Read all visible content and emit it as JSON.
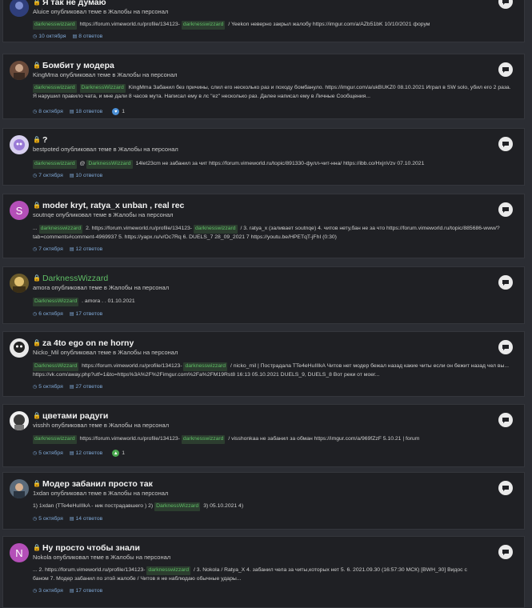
{
  "topics": [
    {
      "title": "Я так не думаю",
      "green_title": false,
      "subtitle": "Aluice опубликовал теме в Жалобы на персонал",
      "tags": [
        "darknesswizzard",
        "darknesswizzard"
      ],
      "snippet_before": "",
      "snippet_parts": [
        "",
        "https://forum.vimeworld.ru/profile/134123-",
        "/ Yeekon неверно закрыл жалобу https://imgur.com/a/AZb51bK 10/10/2021 форум"
      ],
      "date": "10 октября",
      "replies": "8 ответов",
      "reaction": ""
    },
    {
      "title": "Бомбит у модера",
      "subtitle": "KingMma опубликовал теме в Жалобы на персонал",
      "snippet_a": "KingMma Забанил без причины, слил его несколько раз и походу бомбануло. https://imgur.com/a/ukBUKZ0 08.10.2021 Играл в SW solo, убил его 2 раза.",
      "snippet_b": "Я нарушил правило чата, и мне дали 8 часов мута. Написал ему в лс \"ez\" несколько раз. Далее написал ему в Личные Сообщения...",
      "tag1": "darknesswizzard",
      "tag2": "DarknessWizzard",
      "date": "8 октября",
      "replies": "18 ответов",
      "reaction": "1"
    },
    {
      "title": "?",
      "subtitle": "bestpoted опубликовал теме в Жалобы на персонал",
      "tag1": "darknesswizzard",
      "at": "@",
      "tag2": "DarknessWizzard",
      "snippet": "14let23cm не забанил за чит https://forum.vimeworld.ru/topic/891330-фулл-чит-нна/ https://ibb.co/HxjnVzv 07.10.2021",
      "date": "7 октября",
      "replies": "10 ответов"
    },
    {
      "title": "moder kryt, ratya_x unban , real rec",
      "subtitle": "soutnqe опубликовал теме в Жалобы на персонал",
      "avatar_letter": "S",
      "snippet_a_pre": "...",
      "tag1": "darknesswizzard",
      "snippet_a_mid": "2. https://forum.vimeworld.ru/profile/134123-",
      "tag2": "darknesswizzard",
      "snippet_a_post": "/ 3. ratya_x (заливает soutnqe) 4. читов нету,бан не за что https://forum.vimeworld.ru/topic/885686-www/?",
      "snippet_b": "tab=comments#comment-4969937 5. https://yapx.ru/v/Oc7Rq 6. DUELS_7 28_09_2021 7 https://youtu.be/HPETqT-jFhI (0:30)",
      "date": "7 октября",
      "replies": "12 ответов"
    },
    {
      "title": "DarknessWizzard",
      "subtitle": "amora опубликовал теме в Жалобы на персонал",
      "tag1": "DarknessWizzard",
      "snippet": ". amora . . 01.10.2021",
      "date": "6 октября",
      "replies": "17 ответов"
    },
    {
      "title": "za 4to ego on ne horny",
      "subtitle": "Nicko_Mil опубликовал теме в Жалобы на персонал",
      "tag1": "DarknessWizzard",
      "snippet_a_mid": "https://forum.vimeworld.ru/profile/134123-",
      "tag2": "darknesswizzard",
      "snippet_a_post": "/ nicko_mil | Пострадала TTe4eHuIIIkA Читов нет модер бежал назад какие читы если он бежит назад чел вы...",
      "snippet_b": "https://vk.com/away.php?utf=1&to=https%3A%2F%2Fimgur.com%2Fa%2FM19Rst8 16:13 05.10.2021 DUELS_9, DUELS_8 Вот реки от моег...",
      "date": "5 октября",
      "replies": "27 ответов"
    },
    {
      "title": "цветами радуги",
      "subtitle": "visshh опубликовал теме в Жалобы на персонал",
      "tag1": "darknesswizzard",
      "snippet_a_mid": "https://forum.vimeworld.ru/profile/134123-",
      "tag2": "darknesswizzard",
      "snippet_a_post": "/ visshonkaa не забанил за обман https://imgur.com/a/969fZzF 5.10.21 | forum",
      "date": "5 октября",
      "replies": "12 ответов",
      "reaction": "1"
    },
    {
      "title": "Модер забанил просто так",
      "subtitle": "1xdan опубликовал теме в Жалобы на персонал",
      "snippet_pre": "1) 1xdan (TTe4eHuIIIkA - ник пострадавшего ) 2)",
      "tag1": "DarknessWizzard",
      "snippet_post": "3) 05.10.2021 4)",
      "date": "5 октября",
      "replies": "14 ответов"
    },
    {
      "title": "Ну просто чтобы знали",
      "subtitle": "Nokola опубликовал теме в Жалобы на персонал",
      "avatar_letter": "N",
      "snippet_a_pre": "... 2. https://forum.vimeworld.ru/profile/134123-",
      "tag1": "darknesswizzard",
      "snippet_a_post": "/ 3. Nokola / Ratya_X 4. забанил чела за читы,которых нет 5. 6. 2021.09.30 (16:57:30 МСК) [BWH_30] Видос с",
      "snippet_b": "баном 7. Модер забанил по этой жалобе / Читов я не наблюдаю обычные удары...",
      "date": "3 октября",
      "replies": "17 ответов"
    }
  ],
  "icons": {
    "clock": "clock-icon",
    "replies": "comments-icon",
    "chat": "chat-bubble-icon",
    "lock": "lock-icon"
  }
}
